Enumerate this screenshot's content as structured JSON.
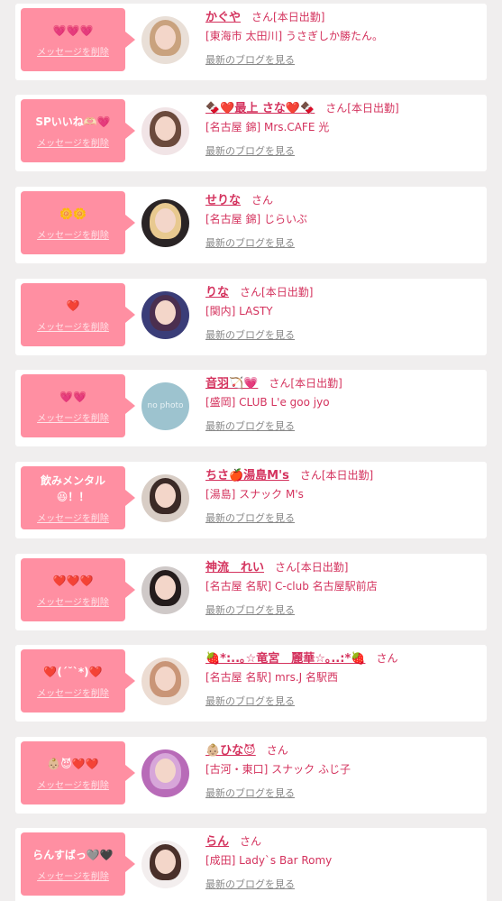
{
  "delete_label": "メッセージを削除",
  "blog_label": "最新のブログを見る",
  "san_label": "さん",
  "items": [
    {
      "reaction": "💗💗💗",
      "name": "かぐや",
      "status": "[本日出勤]",
      "shop": "[東海市 太田川] うさぎしか勝たん。",
      "avatar": {
        "hair": "#c9a27e",
        "bg": "#e9dfd7"
      }
    },
    {
      "reaction": "SPいいね🫶🏻💗",
      "name": "🍫❤️最上 さな❤️🍫",
      "status": "[本日出勤]",
      "shop": "[名古屋 錦] Mrs.CAFE 光",
      "avatar": {
        "hair": "#6b4a3c",
        "bg": "#f1e4e6"
      }
    },
    {
      "reaction": "🌼🌼",
      "name": "せりな",
      "status": "",
      "shop": "[名古屋 錦] じらいぶ",
      "avatar": {
        "hair": "#e8c98f",
        "bg": "#2a2425"
      }
    },
    {
      "reaction": "❤️",
      "name": "りな",
      "status": "[本日出勤]",
      "shop": "[関内] LASTY",
      "avatar": {
        "hair": "#4b2f4f",
        "bg": "#3a3d78"
      }
    },
    {
      "reaction": "💗💗",
      "name": "音羽🏹💗",
      "status": "[本日出勤]",
      "shop": "[盛岡] CLUB L'e goo jyo",
      "avatar": {
        "hair": "none",
        "bg": "#9dc3cf"
      },
      "nophoto": "no photo"
    },
    {
      "reaction": "飲みメンタル\n😆！！",
      "name": "ちさ🍎湯島M's",
      "status": "[本日出勤]",
      "shop": "[湯島] スナック M's",
      "avatar": {
        "hair": "#3b2a26",
        "bg": "#d8cdc5"
      }
    },
    {
      "reaction": "❤️❤️❤️",
      "name": "神流　れい",
      "status": "[本日出勤]",
      "shop": "[名古屋 名駅] C-club 名古屋駅前店",
      "avatar": {
        "hair": "#241c1c",
        "bg": "#cfc9c8"
      }
    },
    {
      "reaction": "❤️(´˘`*)❤️",
      "name": "🍓*:..｡☆竜宮　麗華☆｡..:*🍓",
      "status": "",
      "shop": "[名古屋 名駅] mrs.J 名駅西",
      "avatar": {
        "hair": "#c99577",
        "bg": "#ecdcd2"
      }
    },
    {
      "reaction": "👶🏼😈❤️❤️",
      "name": "👶🏼ひな😈",
      "status": "",
      "shop": "[古河・東口] スナック ふじ子",
      "avatar": {
        "hair": "#d7a6d9",
        "bg": "#b86bb8"
      }
    },
    {
      "reaction": "らんすばっ🩶🖤",
      "name": "らん",
      "status": "",
      "shop": "[成田] Lady`s Bar Romy",
      "avatar": {
        "hair": "#4a302a",
        "bg": "#f3eeee"
      }
    }
  ]
}
